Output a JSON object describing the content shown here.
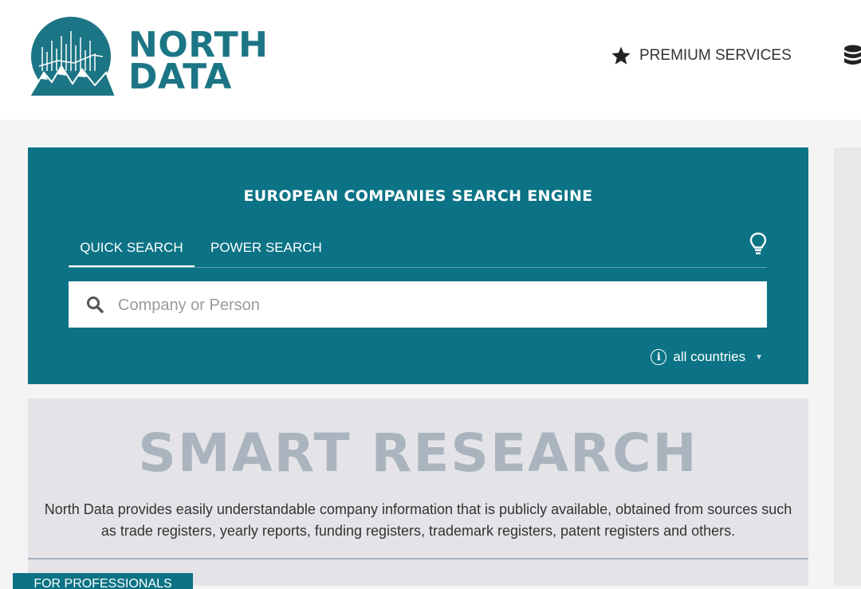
{
  "brand": {
    "line1": "NORTH",
    "line2": "DATA",
    "color": "#1b7585"
  },
  "nav": {
    "premium_label": "PREMIUM SERVICES",
    "premium_icon": "star-icon",
    "database_icon": "database-icon"
  },
  "search": {
    "title": "EUROPEAN COMPANIES SEARCH ENGINE",
    "tabs": [
      {
        "label": "QUICK SEARCH",
        "active": true
      },
      {
        "label": "POWER SEARCH",
        "active": false
      }
    ],
    "placeholder": "Company or Person",
    "value": "",
    "country_label": "all countries",
    "accent": "#0b7385"
  },
  "promo": {
    "title": "SMART RESEARCH",
    "description": "North Data provides easily understandable company information that is publicly available, obtained from sources such as trade registers, yearly reports, funding registers, trademark registers, patent registers and others.",
    "tab_label": "FOR PROFESSIONALS"
  }
}
